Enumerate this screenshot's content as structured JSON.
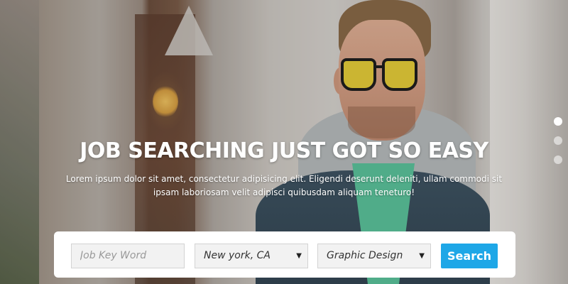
{
  "hero": {
    "headline": "JOB SEARCHING JUST GOT SO EASY",
    "subtext": "Lorem ipsum dolor sit amet, consectetur adipisicing elit. Eligendi deserunt deleniti, ullam commodi sit ipsam laboriosam velit adipisci quibusdam aliquam teneturo!"
  },
  "slider": {
    "dots": 3,
    "active_index": 0
  },
  "search": {
    "keyword_placeholder": "Job Key Word",
    "location_value": "New york, CA",
    "category_value": "Graphic Design",
    "button_label": "Search",
    "caret_icon": "▼",
    "button_color": "#1ea7e7"
  }
}
